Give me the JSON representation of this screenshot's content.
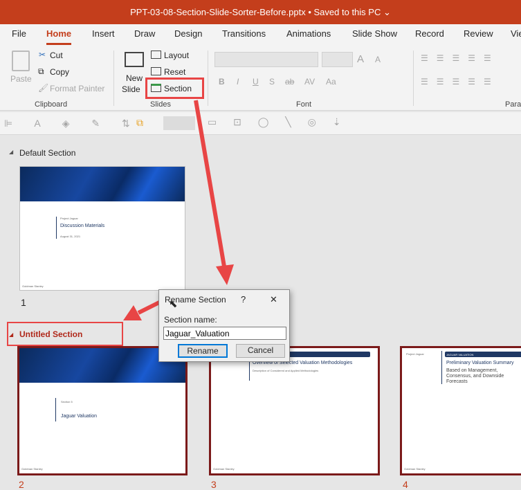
{
  "titlebar": {
    "title": "PPT-03-08-Section-Slide-Sorter-Before.pptx • Saved to this PC ⌄"
  },
  "tabs": [
    "File",
    "Home",
    "Insert",
    "Draw",
    "Design",
    "Transitions",
    "Animations",
    "Slide Show",
    "Record",
    "Review",
    "Vie"
  ],
  "ribbon": {
    "clipboard": {
      "paste": "Paste",
      "cut": "Cut",
      "copy": "Copy",
      "format_painter": "Format Painter",
      "label": "Clipboard"
    },
    "slides": {
      "new_slide": "New",
      "new_slide2": "Slide",
      "layout": "Layout",
      "reset": "Reset",
      "section": "Section",
      "label": "Slides"
    },
    "font": {
      "label": "Font",
      "bold": "B",
      "italic": "I",
      "underline": "U",
      "strike": "S",
      "shadow": "ab",
      "spacing": "AV",
      "case": "Aa",
      "grow": "A",
      "shrink": "A"
    },
    "paragraph": {
      "label": "Para"
    }
  },
  "sections": [
    {
      "name": "Default Section",
      "slides": [
        {
          "number": "1",
          "kicker": "Project Jaguar",
          "title": "Discussion Materials",
          "date": "August 31, 2021",
          "footer": "Goldman Stanley"
        }
      ]
    },
    {
      "name": "Untitled Section",
      "slides": [
        {
          "number": "2",
          "kicker": "Section 5",
          "title": "Jaguar Valuation",
          "footer": "Goldman Stanley"
        },
        {
          "number": "3",
          "title": "Overview of Selected Valuation Methodologies",
          "subtitle": "Description of Considered and Applied Methodologies",
          "footer": "Goldman Stanley"
        },
        {
          "number": "4",
          "kicker": "Project Jaguar",
          "tag": "JAGUAR VALUATION",
          "title": "Preliminary Valuation Summary",
          "subtitle": "Based on Management, Consensus, and Downside Forecasts",
          "footer": "Goldman Stanley"
        }
      ]
    }
  ],
  "dialog": {
    "title": "Rename Section",
    "help": "?",
    "close": "✕",
    "label": "Section name:",
    "value": "Jaguar_Valuation",
    "rename": "Rename",
    "cancel": "Cancel"
  },
  "colors": {
    "accent": "#c43e1c",
    "highlight": "#e84545",
    "selected_border": "#7b1a1a",
    "section_text": "#b0281a"
  }
}
